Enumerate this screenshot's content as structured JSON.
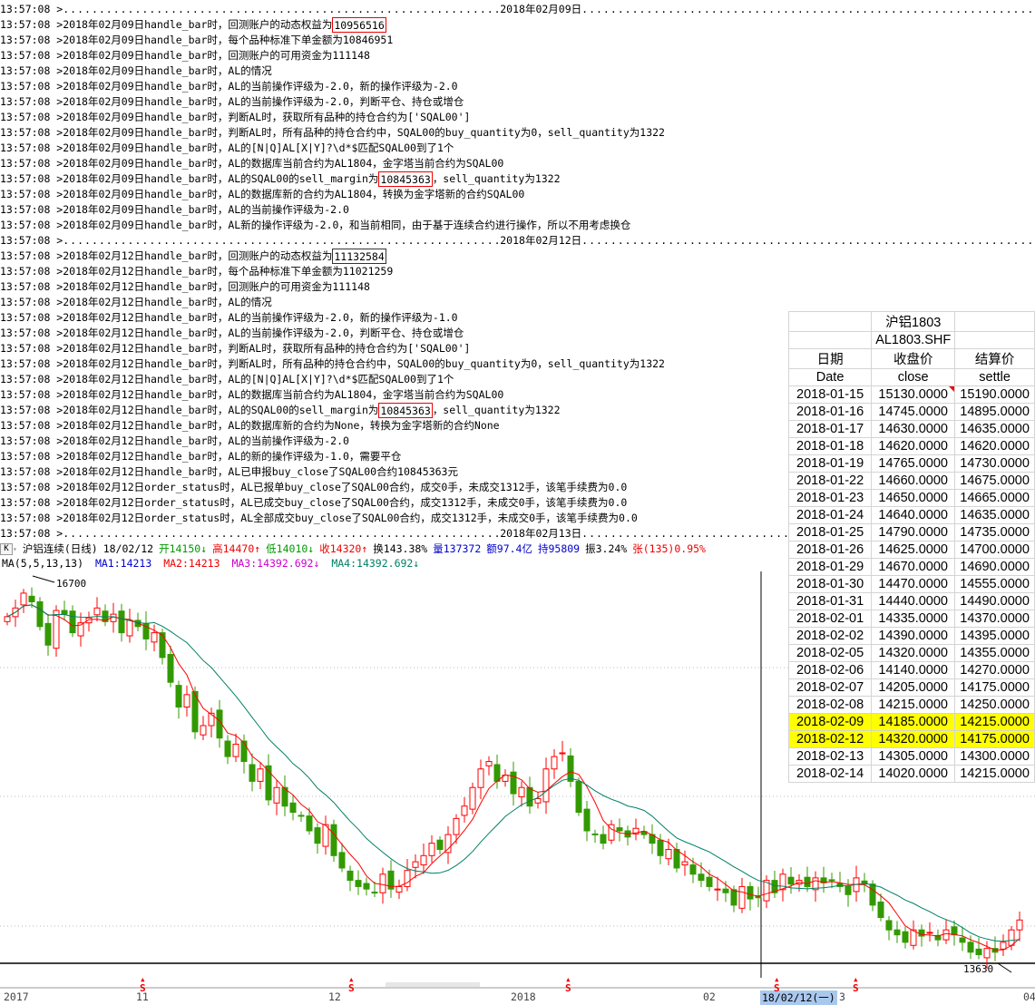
{
  "log": {
    "timestamp": "13:57:08 > ",
    "lines": [
      {
        "sep": "2018年02月09日"
      },
      {
        "t": [
          "2018年02月09日handle_bar时，回测账户的动态权益为",
          "10956516",
          ""
        ],
        "box": "red"
      },
      {
        "t": [
          "2018年02月09日handle_bar时，每个品种标准下单金额为10846951"
        ]
      },
      {
        "t": [
          "2018年02月09日handle_bar时，回测账户的可用资金为111148"
        ]
      },
      {
        "t": [
          "2018年02月09日handle_bar时，AL的情况"
        ]
      },
      {
        "t": [
          "2018年02月09日handle_bar时，AL的当前操作评级为-2.0，新的操作评级为-2.0"
        ]
      },
      {
        "t": [
          "2018年02月09日handle_bar时，AL的当前操作评级为-2.0，判断平仓、持仓或增仓"
        ]
      },
      {
        "t": [
          "2018年02月09日handle_bar时，判断AL时，获取所有品种的持仓合约为['SQAL00']"
        ]
      },
      {
        "t": [
          "2018年02月09日handle_bar时，判断AL时，所有品种的持仓合约中，SQAL00的buy_quantity为0，sell_quantity为1322"
        ]
      },
      {
        "t": [
          "2018年02月09日handle_bar时，AL的[N|Q]AL[X|Y]?\\d*$匹配SQAL00到了1个"
        ]
      },
      {
        "t": [
          "2018年02月09日handle_bar时，AL的数据库当前合约为AL1804，金字塔当前合约为SQAL00"
        ]
      },
      {
        "t": [
          "2018年02月09日handle_bar时，AL的SQAL00的sell_margin为",
          "10845363",
          "，sell_quantity为1322"
        ],
        "box": "red"
      },
      {
        "t": [
          "2018年02月09日handle_bar时，AL的数据库新的合约为AL1804，转换为金字塔新的合约SQAL00"
        ]
      },
      {
        "t": [
          "2018年02月09日handle_bar时，AL的当前操作评级为-2.0"
        ]
      },
      {
        "t": [
          "2018年02月09日handle_bar时，AL新的操作评级为-2.0，和当前相同，由于基于连续合约进行操作，所以不用考虑换仓"
        ]
      },
      {
        "sep": "2018年02月12日"
      },
      {
        "t": [
          "2018年02月12日handle_bar时，回测账户的动态权益为",
          "11132584",
          ""
        ],
        "box": "dark"
      },
      {
        "t": [
          "2018年02月12日handle_bar时，每个品种标准下单金额为11021259"
        ]
      },
      {
        "t": [
          "2018年02月12日handle_bar时，回测账户的可用资金为111148"
        ]
      },
      {
        "t": [
          "2018年02月12日handle_bar时，AL的情况"
        ]
      },
      {
        "t": [
          "2018年02月12日handle_bar时，AL的当前操作评级为-2.0，新的操作评级为-1.0"
        ]
      },
      {
        "t": [
          "2018年02月12日handle_bar时，AL的当前操作评级为-2.0，判断平仓、持仓或增仓"
        ]
      },
      {
        "t": [
          "2018年02月12日handle_bar时，判断AL时，获取所有品种的持仓合约为['SQAL00']"
        ]
      },
      {
        "t": [
          "2018年02月12日handle_bar时，判断AL时，所有品种的持仓合约中，SQAL00的buy_quantity为0，sell_quantity为1322"
        ]
      },
      {
        "t": [
          "2018年02月12日handle_bar时，AL的[N|Q]AL[X|Y]?\\d*$匹配SQAL00到了1个"
        ]
      },
      {
        "t": [
          "2018年02月12日handle_bar时，AL的数据库当前合约为AL1804，金字塔当前合约为SQAL00"
        ]
      },
      {
        "t": [
          "2018年02月12日handle_bar时，AL的SQAL00的sell_margin为",
          "10845363",
          "，sell_quantity为1322"
        ],
        "box": "red"
      },
      {
        "t": [
          "2018年02月12日handle_bar时，AL的数据库新的合约为None，转换为金字塔新的合约None"
        ]
      },
      {
        "t": [
          "2018年02月12日handle_bar时，AL的当前操作评级为-2.0"
        ]
      },
      {
        "t": [
          "2018年02月12日handle_bar时，AL的新的操作评级为-1.0，需要平仓"
        ]
      },
      {
        "t": [
          "2018年02月12日handle_bar时，AL已申报buy_close了SQAL00合约10845363元"
        ]
      },
      {
        "t": [
          "2018年02月12日order_status时，AL已报单buy_close了SQAL00合约，成交0手，未成交1312手，该笔手续费为0.0"
        ]
      },
      {
        "t": [
          "2018年02月12日order_status时，AL已成交buy_close了SQAL00合约，成交1312手，未成交0手，该笔手续费为0.0"
        ]
      },
      {
        "t": [
          "2018年02月12日order_status时，AL全部成交buy_close了SQAL00合约，成交1312手，未成交0手，该笔手续费为0.0"
        ]
      },
      {
        "sep": "2018年02月13日"
      }
    ]
  },
  "info": {
    "k_button": "K",
    "name": "沪铝连续(日线)",
    "date": "18/02/12",
    "open": "开14150↓",
    "high": "高14470↑",
    "low": "低14010↓",
    "close": "收14320↑",
    "turnover": "换143.38%",
    "volume": "量137372",
    "amount": "额97.4亿",
    "position": "持95809",
    "amplitude": "振3.24%",
    "change": "张(135)0.95%"
  },
  "ma": {
    "label": "MA(5,5,13,13)",
    "ma1": "MA1:14213",
    "ma2": "MA2:14213",
    "ma3": "MA3:14392.692↓",
    "ma4": "MA4:14392.692↓"
  },
  "chart_data": {
    "type": "candlestick",
    "high_label": "16700",
    "low_label": "13630",
    "ylim": [
      13630,
      16700
    ],
    "closes": [
      16430,
      16500,
      16620,
      16550,
      16350,
      16200,
      16480,
      16450,
      16300,
      16380,
      16420,
      16500,
      16390,
      16450,
      16300,
      16400,
      16350,
      16250,
      16300,
      16100,
      15900,
      15700,
      15800,
      15500,
      15550,
      15650,
      15450,
      15300,
      15400,
      15260,
      15100,
      15200,
      14950,
      15050,
      14900,
      14850,
      14820,
      14700,
      14600,
      14750,
      14500,
      14400,
      14300,
      14250,
      14230,
      14200,
      14350,
      14230,
      14250,
      14380,
      14450,
      14500,
      14600,
      14550,
      14670,
      14800,
      14900,
      15050,
      15200,
      15260,
      15100,
      15150,
      15000,
      15050,
      14900,
      14960,
      15200,
      15300,
      15330,
      15100,
      14850,
      14700,
      14670,
      14600,
      14750,
      14700,
      14650,
      14720,
      14670,
      14600,
      14500,
      14550,
      14400,
      14450,
      14350,
      14300,
      14250,
      14230,
      14200,
      14100,
      14250,
      14150,
      14160,
      14300,
      14200,
      14350,
      14270,
      14300,
      14250,
      14320,
      14280,
      14300,
      14250,
      14185,
      14320,
      14270,
      14100,
      14000,
      13900,
      13860,
      13800,
      13900,
      13850,
      13880,
      13820,
      13900,
      13860,
      13800,
      13720,
      13700,
      13750,
      13720,
      13800,
      13900,
      13980
    ],
    "colors": {
      "up": "#ff0000",
      "down": "#339900",
      "ma_short": "#ff0000",
      "ma_long": "#008066"
    }
  },
  "axis": {
    "labels": [
      "2017",
      "11",
      "12",
      "2018",
      "02",
      "18/02/12(一)",
      "3",
      "04"
    ],
    "signal": "S"
  },
  "table": {
    "title": "沪铝1803",
    "code": "AL1803.SHF",
    "headers_cn": [
      "日期",
      "收盘价",
      "结算价"
    ],
    "headers_en": [
      "Date",
      "close",
      "settle"
    ],
    "rows": [
      [
        "2018-01-15",
        "15130.0000",
        "15190.0000"
      ],
      [
        "2018-01-16",
        "14745.0000",
        "14895.0000"
      ],
      [
        "2018-01-17",
        "14630.0000",
        "14635.0000"
      ],
      [
        "2018-01-18",
        "14620.0000",
        "14620.0000"
      ],
      [
        "2018-01-19",
        "14765.0000",
        "14730.0000"
      ],
      [
        "2018-01-22",
        "14660.0000",
        "14675.0000"
      ],
      [
        "2018-01-23",
        "14650.0000",
        "14665.0000"
      ],
      [
        "2018-01-24",
        "14640.0000",
        "14635.0000"
      ],
      [
        "2018-01-25",
        "14790.0000",
        "14735.0000"
      ],
      [
        "2018-01-26",
        "14625.0000",
        "14700.0000"
      ],
      [
        "2018-01-29",
        "14670.0000",
        "14690.0000"
      ],
      [
        "2018-01-30",
        "14470.0000",
        "14555.0000"
      ],
      [
        "2018-01-31",
        "14440.0000",
        "14490.0000"
      ],
      [
        "2018-02-01",
        "14335.0000",
        "14370.0000"
      ],
      [
        "2018-02-02",
        "14390.0000",
        "14395.0000"
      ],
      [
        "2018-02-05",
        "14320.0000",
        "14355.0000"
      ],
      [
        "2018-02-06",
        "14140.0000",
        "14270.0000"
      ],
      [
        "2018-02-07",
        "14205.0000",
        "14175.0000"
      ],
      [
        "2018-02-08",
        "14215.0000",
        "14250.0000"
      ],
      [
        "2018-02-09",
        "14185.0000",
        "14215.0000"
      ],
      [
        "2018-02-12",
        "14320.0000",
        "14175.0000"
      ],
      [
        "2018-02-13",
        "14305.0000",
        "14300.0000"
      ],
      [
        "2018-02-14",
        "14020.0000",
        "14215.0000"
      ]
    ],
    "highlight_rows": [
      "2018-02-09",
      "2018-02-12"
    ]
  }
}
